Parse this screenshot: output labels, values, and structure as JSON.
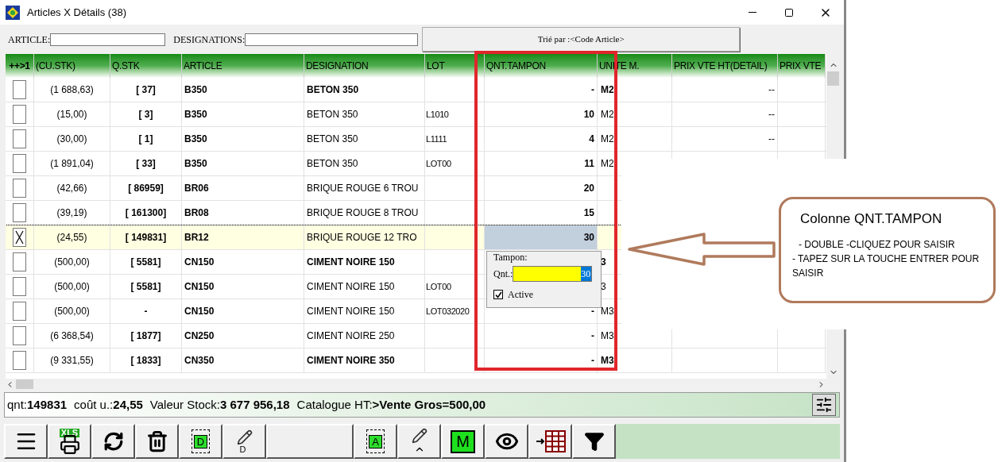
{
  "window": {
    "title": "Articles X Détails (38)"
  },
  "filters": [
    {
      "label": "ARTICLE:"
    },
    {
      "label": "DESIGNATIONS:"
    }
  ],
  "sort_button": "Trié par :<Code Article>",
  "table": {
    "columns": [
      "++>1",
      "(CU.STK)",
      "Q.STK",
      "ARTICLE",
      "DESIGNATION",
      "LOT",
      "QNT.TAMPON",
      "UNITE M.",
      "PRIX VTE HT(DETAIL)",
      "PRIX VTE"
    ],
    "rows": [
      {
        "checked": false,
        "selected": false,
        "emphasized": true,
        "cost": "(1 688,63)",
        "stock": "[ 37]",
        "article": "B350",
        "designation": "BETON 350",
        "tampon": "-",
        "unit": "M2",
        "price": "--"
      },
      {
        "checked": false,
        "selected": false,
        "emphasized": false,
        "cost": "(15,00)",
        "stock": "[ 3]",
        "article": "B350",
        "designation": "BETON 350",
        "lot": "L1010",
        "tampon": "10",
        "unit": "M2",
        "price": "--"
      },
      {
        "checked": false,
        "selected": false,
        "emphasized": false,
        "cost": "(30,00)",
        "stock": "[ 1]",
        "article": "B350",
        "designation": "BETON 350",
        "lot": "L1111",
        "tampon": "4",
        "unit": "M2",
        "price": "--"
      },
      {
        "checked": false,
        "selected": false,
        "emphasized": false,
        "cost": "(1 891,04)",
        "stock": "[ 33]",
        "article": "B350",
        "designation": "BETON 350",
        "lot": "LOT00",
        "tampon": "11",
        "unit": "M2"
      },
      {
        "checked": false,
        "selected": false,
        "emphasized": false,
        "cost": "(42,66)",
        "stock": "[ 86959]",
        "article": "BR06",
        "designation": "BRIQUE ROUGE 6 TROU",
        "tampon": "20"
      },
      {
        "checked": false,
        "selected": false,
        "emphasized": false,
        "cost": "(39,19)",
        "stock": "[ 161300]",
        "article": "BR08",
        "designation": "BRIQUE ROUGE 8 TROU",
        "tampon": "15"
      },
      {
        "checked": true,
        "selected": true,
        "emphasized": false,
        "cost": "(24,55)",
        "stock": "[ 149831]",
        "article": "BR12",
        "designation": "BRIQUE ROUGE 12 TRO",
        "tampon": "30"
      },
      {
        "checked": false,
        "selected": false,
        "emphasized": true,
        "cost": "(500,00)",
        "stock": "[ 5581]",
        "article": "CN150",
        "designation": "CIMENT NOIRE 150",
        "unit": "3"
      },
      {
        "checked": false,
        "selected": false,
        "emphasized": false,
        "cost": "(500,00)",
        "stock": "[ 5581]",
        "article": "CN150",
        "designation": "CIMENT NOIRE 150",
        "lot": "LOT00",
        "unit": "3"
      },
      {
        "checked": false,
        "selected": false,
        "emphasized": false,
        "cost": "(500,00)",
        "stock": "-",
        "article": "CN150",
        "designation": "CIMENT NOIRE 150",
        "lot": "LOT032020",
        "tampon": "-",
        "unit": "M3"
      },
      {
        "checked": false,
        "selected": false,
        "emphasized": false,
        "cost": "(6 368,54)",
        "stock": "[ 1877]",
        "article": "CN250",
        "designation": "CIMENT NOIRE 250",
        "tampon": "-",
        "unit": "M3"
      },
      {
        "checked": false,
        "selected": false,
        "emphasized": true,
        "cost": "(9 331,55)",
        "stock": "[ 1833]",
        "article": "CN350",
        "designation": "CIMENT NOIRE 350",
        "tampon": "-",
        "unit": "M3"
      }
    ]
  },
  "tampon_popup": {
    "group": "Tampon:",
    "qnt_label": "Qnt.:",
    "qnt_value": "30",
    "active": {
      "label": "Active",
      "checked": true
    }
  },
  "status_bar": [
    {
      "label": "qnt:",
      "value": "149831"
    },
    {
      "label": "coût u.:",
      "value": "24,55"
    },
    {
      "label": "Valeur Stock:",
      "value": "3 677 956,18"
    },
    {
      "label": "Catalogue HT:",
      "value": ">Vente Gros=500,00"
    }
  ],
  "toolbar": [
    {
      "kind": "menu"
    },
    {
      "kind": "xls",
      "label": "XLS"
    },
    {
      "kind": "refresh"
    },
    {
      "kind": "trash"
    },
    {
      "kind": "box",
      "label": "D"
    },
    {
      "kind": "edit",
      "label": "D"
    },
    {
      "kind": "blank"
    },
    {
      "kind": "box",
      "label": "A"
    },
    {
      "kind": "edit-up"
    },
    {
      "kind": "green",
      "label": "M"
    },
    {
      "kind": "eye"
    },
    {
      "kind": "grid"
    },
    {
      "kind": "filter"
    }
  ],
  "annotation": {
    "title": "Colonne QNT.TAMPON",
    "lines": [
      "- DOUBLE -CLIQUEZ POUR SAISIR",
      "- TAPEZ SUR LA TOUCHE ENTRER POUR SAISIR"
    ]
  }
}
